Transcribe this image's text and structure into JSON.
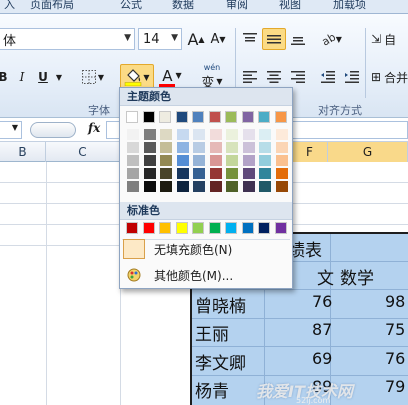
{
  "ribbon_tabs": [
    "入",
    "页面布局",
    "公式",
    "数据",
    "审阅",
    "视图",
    "加载项"
  ],
  "font": {
    "name_value": "体",
    "size_value": "14",
    "bold": "B",
    "italic": "I",
    "underline": "U",
    "phonetic": "变",
    "font_color_letter": "A",
    "grow_letter": "A",
    "shrink_letter": "A"
  },
  "groups": {
    "font_label": "字体",
    "align_label": "对齐方式"
  },
  "right_edge": {
    "wrap_label": "自",
    "merge_label": "合并"
  },
  "formula_bar": {
    "fx_label": "fx"
  },
  "columns": {
    "b": "B",
    "c": "C",
    "f": "F",
    "g": "G"
  },
  "sheet": {
    "title_fragment": "绩表",
    "header_partial": "文",
    "header_math": "数学",
    "rows": [
      {
        "name": "曾晓楠",
        "c1": "76",
        "c2": "98"
      },
      {
        "name": "王丽",
        "c1": "87",
        "c2": "75"
      },
      {
        "name": "李文卿",
        "c1": "69",
        "c2": "76"
      },
      {
        "name": "杨青",
        "c1": "89",
        "c2": "79"
      }
    ]
  },
  "watermark": {
    "text": "我爱IT技术网",
    "url": "52ij.com"
  },
  "color_picker": {
    "theme_label": "主题颜色",
    "standard_label": "标准色",
    "no_fill_label": "无填充颜色(N)",
    "more_label": "其他颜色(M)...",
    "theme_base": [
      "#ffffff",
      "#000000",
      "#eeece1",
      "#1f497d",
      "#4f81bd",
      "#c0504d",
      "#9bbb59",
      "#8064a2",
      "#4bacc6",
      "#f79646"
    ],
    "theme_shades": [
      [
        "#f2f2f2",
        "#7f7f7f",
        "#ddd9c3",
        "#c6d9f0",
        "#dbe5f1",
        "#f2dcdb",
        "#ebf1dd",
        "#e5e0ec",
        "#dbeef3",
        "#fdeada"
      ],
      [
        "#d8d8d8",
        "#595959",
        "#c4bd97",
        "#8db3e2",
        "#b8cce4",
        "#e5b9b7",
        "#d7e3bc",
        "#ccc1d9",
        "#b7dde8",
        "#fbd5b5"
      ],
      [
        "#bfbfbf",
        "#3f3f3f",
        "#938953",
        "#548dd4",
        "#95b3d7",
        "#d99694",
        "#c3d69b",
        "#b2a2c7",
        "#92cddc",
        "#fac08f"
      ],
      [
        "#a5a5a5",
        "#262626",
        "#494429",
        "#17365d",
        "#366092",
        "#953734",
        "#76923c",
        "#5f497a",
        "#31859b",
        "#e36c09"
      ],
      [
        "#7f7f7f",
        "#0c0c0c",
        "#1d1b10",
        "#0f243e",
        "#244061",
        "#632423",
        "#4f6128",
        "#3f3151",
        "#205867",
        "#974806"
      ]
    ],
    "standard": [
      "#c00000",
      "#ff0000",
      "#ffc000",
      "#ffff00",
      "#92d050",
      "#00b050",
      "#00b0f0",
      "#0070c0",
      "#002060",
      "#7030a0"
    ]
  }
}
